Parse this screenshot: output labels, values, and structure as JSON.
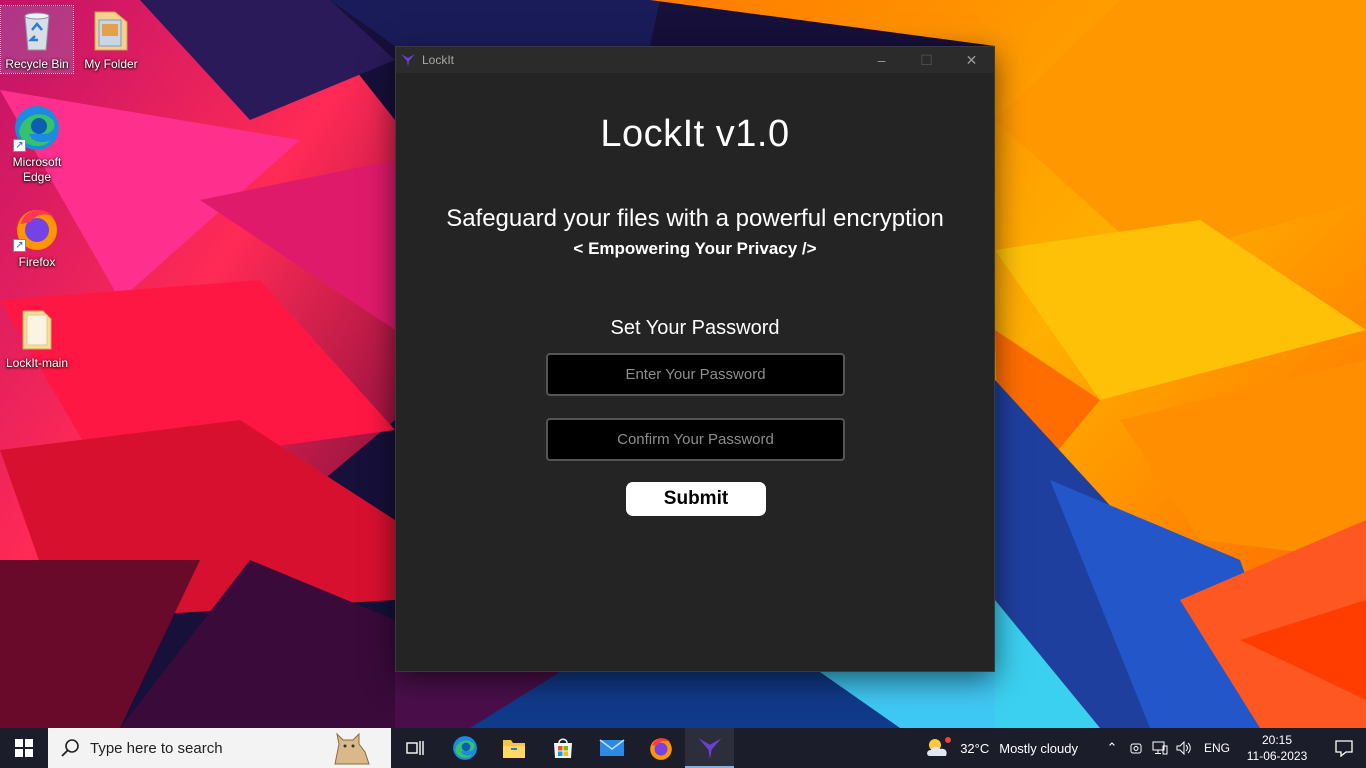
{
  "desktop": {
    "icons": [
      {
        "label": "Recycle Bin",
        "icon": "recycle-bin-icon"
      },
      {
        "label": "My Folder",
        "icon": "folder-icon"
      },
      {
        "label": "Microsoft Edge",
        "icon": "edge-icon"
      },
      {
        "label": "Firefox",
        "icon": "firefox-icon"
      },
      {
        "label": "LockIt-main",
        "icon": "folder-icon"
      }
    ]
  },
  "window": {
    "title": "LockIt",
    "heading": "LockIt v1.0",
    "tagline": "Safeguard your files with a powerful encryption",
    "subtagline": "< Empowering Your Privacy />",
    "set_password_label": "Set Your Password",
    "password_placeholder": "Enter Your Password",
    "confirm_placeholder": "Confirm Your Password",
    "submit_label": "Submit",
    "colors": {
      "background": "#242424",
      "input_bg": "#000000",
      "button_bg": "#ffffff",
      "accent": "#6b3fd1"
    }
  },
  "taskbar": {
    "search_placeholder": "Type here to search",
    "apps": [
      "task-view-icon",
      "edge-icon",
      "file-explorer-icon",
      "store-icon",
      "mail-icon",
      "firefox-icon",
      "lockit-icon"
    ],
    "active_app": "lockit-icon",
    "weather": {
      "temp": "32°C",
      "condition": "Mostly cloudy"
    },
    "language": "ENG",
    "time": "20:15",
    "date": "11-06-2023"
  }
}
